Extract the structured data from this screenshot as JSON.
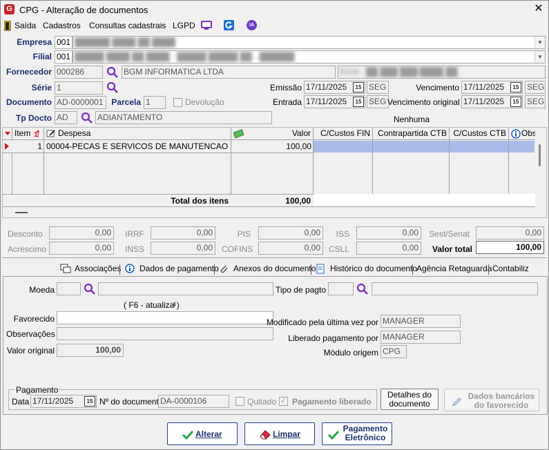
{
  "window": {
    "title": "CPG - Alteração de documentos",
    "app_icon": "G",
    "close": "✕"
  },
  "menu": [
    "Saída",
    "Cadastros",
    "Consultas cadastrais",
    "LGPD"
  ],
  "menu_icons": [
    "monitor-icon",
    "g-app-icon",
    "ia-icon"
  ],
  "ia_label": "IA",
  "header": {
    "empresa_label": "Empresa",
    "empresa_code": "001",
    "empresa_name": "██████ ████ ██ ████",
    "filial_label": "Filial",
    "filial_code": "001",
    "filial_name": "█████ ████ ██ ████ - █████ █████ ██ - ██████",
    "fornecedor_label": "Fornecedor",
    "fornecedor_code": "000286",
    "fornecedor_name": "BGM INFORMATICA LTDA",
    "fornecedor_doc": "BGM - ██ ███ ███/████ ██",
    "serie_label": "Série",
    "serie_value": "1",
    "documento_label": "Documento",
    "documento_value": "AD-0000001",
    "parcela_label": "Parcela",
    "parcela_value": "1",
    "devolucao_label": "Devolução",
    "tpdocto_label": "Tp Docto",
    "tpdocto_code": "AD",
    "tpdocto_name": "ADIANTAMENTO",
    "emissao_label": "Emissão",
    "emissao_date": "17/11/2025",
    "emissao_day": "SEG",
    "entrada_label": "Entrada",
    "entrada_date": "17/11/2025",
    "entrada_day": "SEG",
    "vencimento_label": "Vencimento",
    "vencimento_date": "17/11/2025",
    "vencimento_day": "SEG",
    "venc_original_label": "Vencimento original",
    "venc_original_date": "17/11/2025",
    "venc_original_day": "SEG",
    "nenhuma": "Nenhuma",
    "cal_glyph": "15"
  },
  "grid": {
    "columns": [
      "Item",
      "Despesa",
      "Valor",
      "C/Custos FIN",
      "Contrapartida CTB",
      "C/Custos CTB",
      "Obs"
    ],
    "rows": [
      {
        "item": "1",
        "despesa": "00004-PECAS E SERVICOS DE MANUTENCAO",
        "valor": "100,00"
      }
    ],
    "total_label": "Total dos itens",
    "total_value": "100,00"
  },
  "totals": {
    "desconto_label": "Desconto",
    "desconto": "0,00",
    "acrescimo_label": "Acréscimo",
    "acrescimo": "0,00",
    "irrf_label": "IRRF",
    "irrf": "0,00",
    "inss_label": "INSS",
    "inss": "0,00",
    "pis_label": "PIS",
    "pis": "0,00",
    "cofins_label": "COFINS",
    "cofins": "0,00",
    "iss_label": "ISS",
    "iss": "0,00",
    "csll_label": "CSLL",
    "csll": "0,00",
    "sest_label": "Sest/Senat",
    "sest": "0,00",
    "valor_total_label": "Valor total",
    "valor_total": "100,00"
  },
  "tabs": [
    "Associações",
    "Dados de pagamento",
    "Anexos do documento",
    "Histórico do documento",
    "Agência Retaguarda",
    "Contabiliz"
  ],
  "payment": {
    "moeda_label": "Moeda",
    "tipo_pagto_label": "Tipo de pagto",
    "f6_hint": "( F6 - atualiza )",
    "favorecido_label": "Favorecido",
    "favorecido_value": "",
    "observacoes_label": "Observações",
    "valor_original_label": "Valor original",
    "valor_original": "100,00",
    "modificado_label": "Modificado pela última vez por",
    "modificado_value": "MANAGER",
    "liberado_label": "Liberado pagamento por",
    "liberado_value": "MANAGER",
    "modulo_label": "Módulo origem",
    "modulo_value": "CPG",
    "group_title": "Pagamento",
    "data_label": "Data",
    "data_value": "17/11/2025",
    "ndoc_label": "Nº do documento",
    "ndoc_value": "DA-0000106",
    "quitado_label": "Quitado",
    "pagamento_liberado_label": "Pagamento liberado",
    "detalhes_label": "Detalhes do documento",
    "dados_bancarios_label": "Dados bancários do favorecido"
  },
  "buttons": {
    "alterar": "Alterar",
    "limpar": "Limpar",
    "pagamento_eletronico": "Pagamento Eletrônico"
  },
  "colors": {
    "label_blue": "#1a2f6b",
    "selection": "#a9bde8",
    "brand_red": "#c8232c",
    "accent_purple": "#9b59d6"
  }
}
